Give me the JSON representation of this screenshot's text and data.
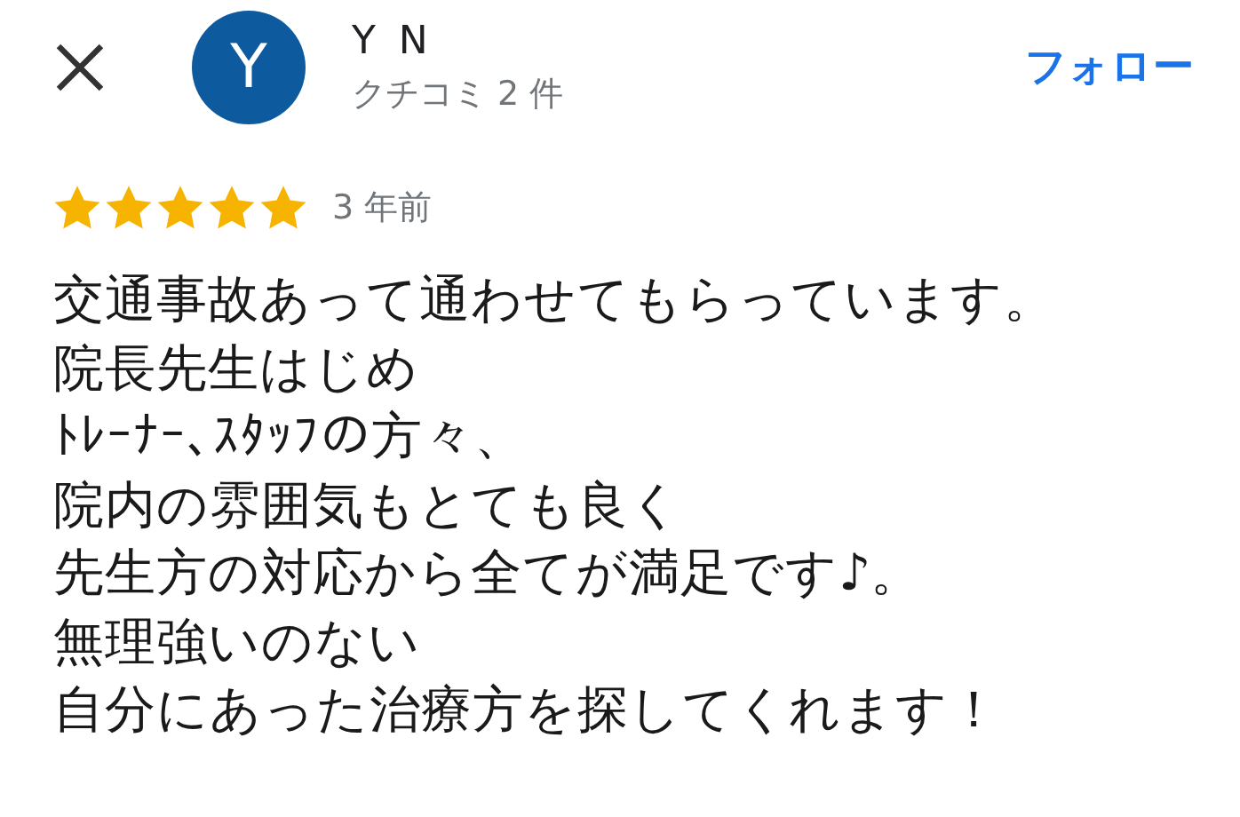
{
  "reviewer": {
    "avatar_letter": "Y",
    "name": "Y N",
    "review_count": "クチコミ 2 件"
  },
  "follow_button": "フォロー",
  "review": {
    "stars": 5,
    "time": "3 年前",
    "lines": [
      "交通事故あって通わせてもらっています。",
      "院長先生はじめ",
      "ﾄﾚｰﾅｰ､ｽﾀｯﾌの方々、",
      "院内の雰囲気もとても良く",
      "先生方の対応から全てが満足です♪。",
      "無理強いのない",
      "自分にあった治療方を探してくれます！"
    ]
  }
}
